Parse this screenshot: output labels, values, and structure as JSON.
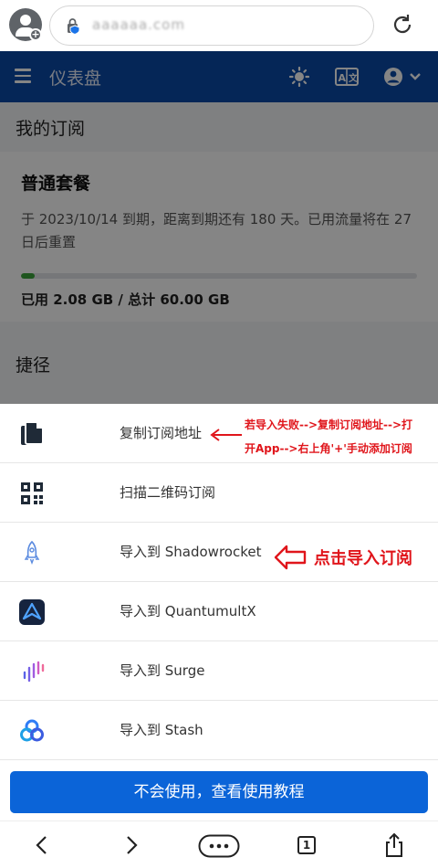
{
  "browser": {
    "url": "aaaaaa.com",
    "tab_count": "1"
  },
  "header": {
    "title": "仪表盘"
  },
  "subscription": {
    "section_title": "我的订阅",
    "plan_name": "普通套餐",
    "description": "于 2023/10/14 到期，距离到期还有 180 天。已用流量将在 27 日后重置",
    "usage_text": "已用 2.08 GB / 总计 60.00 GB",
    "usage_fraction": 0.035
  },
  "shortcuts": {
    "section_title": "捷径"
  },
  "sheet": {
    "items": [
      {
        "label": "复制订阅地址",
        "icon": "copy-icon"
      },
      {
        "label": "扫描二维码订阅",
        "icon": "qr-code-icon"
      },
      {
        "label": "导入到 Shadowrocket",
        "icon": "rocket-icon"
      },
      {
        "label": "导入到 QuantumultX",
        "icon": "quantumultx-icon"
      },
      {
        "label": "导入到 Surge",
        "icon": "surge-icon"
      },
      {
        "label": "导入到 Stash",
        "icon": "stash-icon"
      }
    ],
    "help_button": "不会使用，查看使用教程"
  },
  "annotations": {
    "copy_note_line1": "若导入失败-->复制订阅地址-->打",
    "copy_note_line2": "开App-->右上角'+'手动添加订阅",
    "click_note": "点击导入订阅"
  },
  "colors": {
    "header": "#0a4aa8",
    "button": "#0b64d8",
    "annotation": "#e0151b",
    "progress": "#3aa33a"
  }
}
